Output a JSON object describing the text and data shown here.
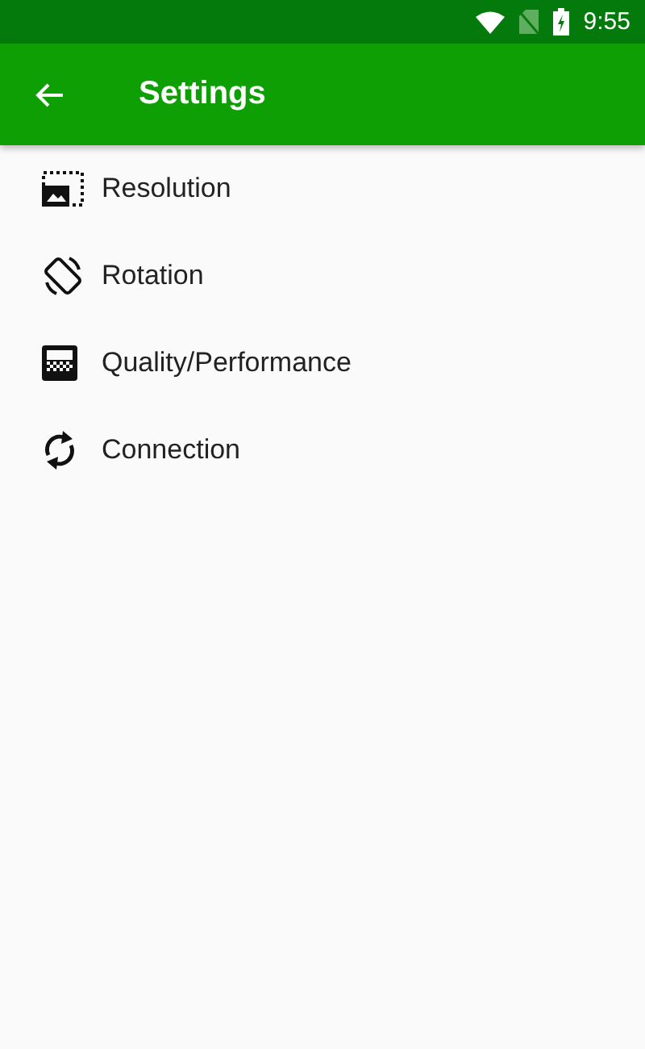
{
  "status_bar": {
    "time": "9:55"
  },
  "toolbar": {
    "title": "Settings"
  },
  "items": [
    {
      "kind": "resolution",
      "label": "Resolution"
    },
    {
      "kind": "rotation",
      "label": "Rotation"
    },
    {
      "kind": "quality",
      "label": "Quality/Performance"
    },
    {
      "kind": "connection",
      "label": "Connection"
    }
  ]
}
